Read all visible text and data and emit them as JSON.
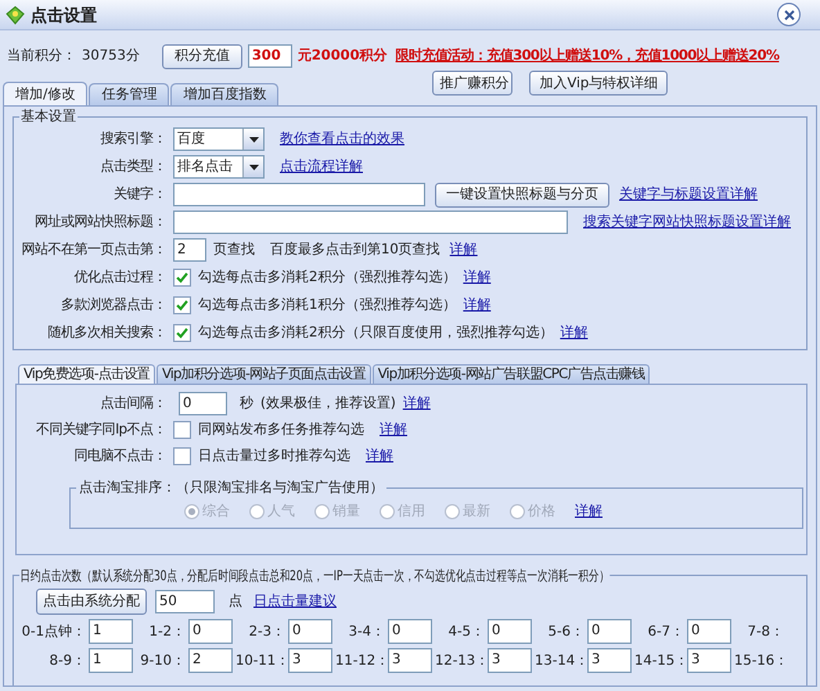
{
  "window": {
    "title": "点击设置"
  },
  "points": {
    "label": "当前积分：",
    "value": "30753分",
    "recharge_button": "积分充值",
    "amount": "300",
    "rate": "元20000积分",
    "promo_link": "限时充值活动：充值300以上赠送10%，充值1000以上赠送20%"
  },
  "buttons": [
    "推广赚积分",
    "加入Vip与特权详细"
  ],
  "tabs": [
    {
      "label": "增加/修改",
      "selected": true
    },
    {
      "label": "任务管理",
      "selected": false
    },
    {
      "label": "增加百度指数",
      "selected": false
    }
  ],
  "basic_settings": {
    "title": "基本设置",
    "rows": [
      {
        "kind": "select",
        "label": "搜索引擎：",
        "value": "百度",
        "link": "教你查看点击的效果"
      },
      {
        "kind": "select",
        "label": "点击类型：",
        "value": "排名点击",
        "link": "点击流程详解"
      },
      {
        "kind": "keyword",
        "label": "关键字：",
        "button": "一键设置快照标题与分页",
        "link": "关键字与标题设置详解"
      },
      {
        "kind": "wide",
        "label": "网址或网站快照标题：",
        "link": "搜索关键字网站快照标题设置详解"
      },
      {
        "kind": "page",
        "label": "网站不在第一页点击第：",
        "value": "2",
        "unit": "页查找",
        "note": "百度最多点击到第10页查找",
        "link": "详解"
      },
      {
        "kind": "checkbox",
        "label": "优化点击过程：",
        "checked": true,
        "text": "勾选每点击多消耗2积分（强烈推荐勾选）",
        "link": "详解"
      },
      {
        "kind": "checkbox",
        "label": "多款浏览器点击：",
        "checked": true,
        "text": "勾选每点击多消耗1积分（强烈推荐勾选）",
        "link": "详解"
      },
      {
        "kind": "checkbox",
        "label": "随机多次相关搜索：",
        "checked": true,
        "text": "勾选每点击多消耗2积分（只限百度使用，强烈推荐勾选）",
        "link": "详解"
      }
    ]
  },
  "vip_tabs": [
    {
      "label": "Vip免费选项-点击设置",
      "selected": true
    },
    {
      "label": "Vip加积分选项-网站子页面点击设置",
      "selected": false
    },
    {
      "label": "Vip加积分选项-网站广告联盟CPC广告点击赚钱",
      "selected": false
    }
  ],
  "vip_settings": {
    "rows": [
      {
        "kind": "seconds",
        "label": "点击间隔：",
        "value": "0",
        "unit": "秒",
        "text": "(效果极佳，推荐设置)",
        "link": "详解"
      },
      {
        "kind": "checkbox",
        "label": "不同关键字同Ip不点：",
        "checked": false,
        "text": "同网站发布多任务推荐勾选",
        "link": "详解"
      },
      {
        "kind": "checkbox",
        "label": "同电脑不点击：",
        "checked": false,
        "text": "日点击量过多时推荐勾选",
        "link": "详解"
      }
    ],
    "taobao": {
      "title": "点击淘宝排序：（只限淘宝排名与淘宝广告使用）",
      "disabled": true,
      "link": "详解",
      "options": [
        {
          "label": "综合",
          "selected": true
        },
        {
          "label": "人气",
          "selected": false
        },
        {
          "label": "销量",
          "selected": false
        },
        {
          "label": "信用",
          "selected": false
        },
        {
          "label": "最新",
          "selected": false
        },
        {
          "label": "价格",
          "selected": false
        }
      ]
    }
  },
  "daily_clicks": {
    "title": "日约点击次数（默认系统分配30点，分配后时间段点击总和20点，一IP一天点击一次，不勾选优化点击过程等点一次消耗一积分）",
    "button": "点击由系统分配",
    "value": "50",
    "unit": "点",
    "link": "日点击量建议",
    "slots": [
      {
        "label": "0-1点钟：",
        "value": "1"
      },
      {
        "label": "1-2：",
        "value": "0"
      },
      {
        "label": "2-3：",
        "value": "0"
      },
      {
        "label": "3-4：",
        "value": "0"
      },
      {
        "label": "4-5：",
        "value": "0"
      },
      {
        "label": "5-6：",
        "value": "0"
      },
      {
        "label": "6-7：",
        "value": "0"
      },
      {
        "label": "7-8："
      },
      {
        "label": "8-9：",
        "value": "1"
      },
      {
        "label": "9-10：",
        "value": "2"
      },
      {
        "label": "10-11：",
        "value": "3"
      },
      {
        "label": "11-12：",
        "value": "3"
      },
      {
        "label": "12-13：",
        "value": "3"
      },
      {
        "label": "13-14：",
        "value": "3"
      },
      {
        "label": "14-15：",
        "value": "3"
      },
      {
        "label": "15-16："
      }
    ]
  }
}
